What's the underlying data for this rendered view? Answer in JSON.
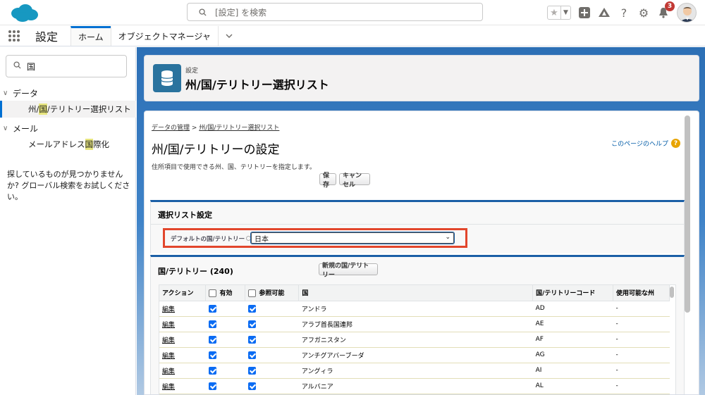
{
  "header": {
    "search_placeholder": "[設定] を検索",
    "notification_count": "3"
  },
  "context": {
    "app_name": "設定",
    "tabs": [
      {
        "label": "ホーム"
      },
      {
        "label": "オブジェクトマネージャ"
      }
    ]
  },
  "sidebar": {
    "quickfind_value": "国",
    "groups": [
      {
        "label": "データ",
        "item_before": "州/",
        "item_match": "国",
        "item_after": "/テリトリー選択リスト"
      },
      {
        "label": "メール",
        "item_before": "メールアドレス",
        "item_match": "国",
        "item_after": "際化"
      }
    ],
    "no_result_text": "探しているものが見つかりませんか? グローバル検索をお試しください。"
  },
  "page_header": {
    "subtitle": "設定",
    "title": "州/国/テリトリー選択リスト"
  },
  "content": {
    "breadcrumb_1": "データの管理",
    "breadcrumb_sep": " > ",
    "breadcrumb_2": "州/国/テリトリー選択リスト",
    "title": "州/国/テリトリーの設定",
    "help_link": "このページのヘルプ",
    "description": "住所項目で使用できる州、国、テリトリーを指定します。",
    "save_label": "保存",
    "cancel_label": "キャンセル",
    "picklist_section_title": "選択リスト設定",
    "default_country_label": "デフォルトの国/テリトリー",
    "default_country_value": "日本",
    "country_section_title": "国/テリトリー (240)",
    "new_country_label": "新規の国/テリトリー",
    "columns": {
      "action": "アクション",
      "active": "有効",
      "visible": "参照可能",
      "country": "国",
      "code": "国/テリトリーコード",
      "states": "使用可能な州"
    },
    "rows": [
      {
        "action": "編集",
        "country": "アンドラ",
        "code": "AD",
        "states": "-"
      },
      {
        "action": "編集",
        "country": "アラブ首長国連邦",
        "code": "AE",
        "states": "-"
      },
      {
        "action": "編集",
        "country": "アフガニスタン",
        "code": "AF",
        "states": "-"
      },
      {
        "action": "編集",
        "country": "アンチグアバーブーダ",
        "code": "AG",
        "states": "-"
      },
      {
        "action": "編集",
        "country": "アングィラ",
        "code": "AI",
        "states": "-"
      },
      {
        "action": "編集",
        "country": "アルバニア",
        "code": "AL",
        "states": "-"
      }
    ]
  },
  "colors": {
    "brand": "#0070d2",
    "highlight_box": "#e2462c",
    "checkbox": "#0b6cf3"
  }
}
